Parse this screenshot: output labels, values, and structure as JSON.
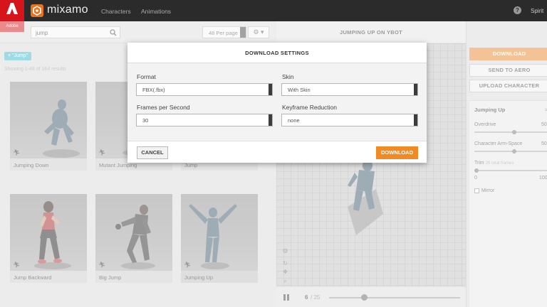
{
  "topbar": {
    "adobe_label": "Adobe",
    "brand": "mixamo",
    "nav": [
      "Characters",
      "Animations"
    ],
    "help_icon": "?",
    "user_name": "Spirit"
  },
  "search": {
    "value": "jump",
    "placeholder": ""
  },
  "toolbar": {
    "per_page": "48 Per page",
    "settings_icon": "⚙ ▾"
  },
  "filter_chip": "× \"Jump\"",
  "results_text": "Showing 1-48 of 164 results",
  "cards": [
    {
      "title": "Jumping Down",
      "icon": "runner-icon"
    },
    {
      "title": "Mutant Jumping",
      "icon": "runner-icon"
    },
    {
      "title": "Jump",
      "icon": "runner-icon"
    },
    {
      "title": "Jump Backward",
      "icon": "runner-icon"
    },
    {
      "title": "Big Jump",
      "icon": "runner-icon"
    },
    {
      "title": "Jumping Up",
      "icon": "runner-icon"
    }
  ],
  "viewer": {
    "title": "JUMPING UP ON YBOT",
    "frame_current": "6",
    "frame_total": " / 25",
    "progress": 0.24
  },
  "side": {
    "download": "DOWNLOAD",
    "send_aero": "SEND TO AERO",
    "upload_char": "UPLOAD CHARACTER",
    "anim_title": "Jumping Up",
    "anim_close": ">",
    "overdrive_label": "Overdrive",
    "overdrive_value": "50",
    "armspace_label": "Character Arm-Space",
    "armspace_value": "50",
    "trim_label": "Trim",
    "trim_sub": "26 total frames",
    "trim_min": "0",
    "trim_max": "100",
    "mirror_label": "Mirror"
  },
  "modal": {
    "title": "DOWNLOAD SETTINGS",
    "format_label": "Format",
    "format_value": "FBX(.fbx)",
    "skin_label": "Skin",
    "skin_value": "With Skin",
    "fps_label": "Frames per Second",
    "fps_value": "30",
    "keyframe_label": "Keyframe Reduction",
    "keyframe_value": "none",
    "cancel": "CANCEL",
    "download": "DOWNLOAD"
  },
  "colors": {
    "accent": "#f18a22",
    "chip": "#3fb6c6",
    "adobe_red": "#d5141b",
    "topbar": "#2b2b2b"
  }
}
